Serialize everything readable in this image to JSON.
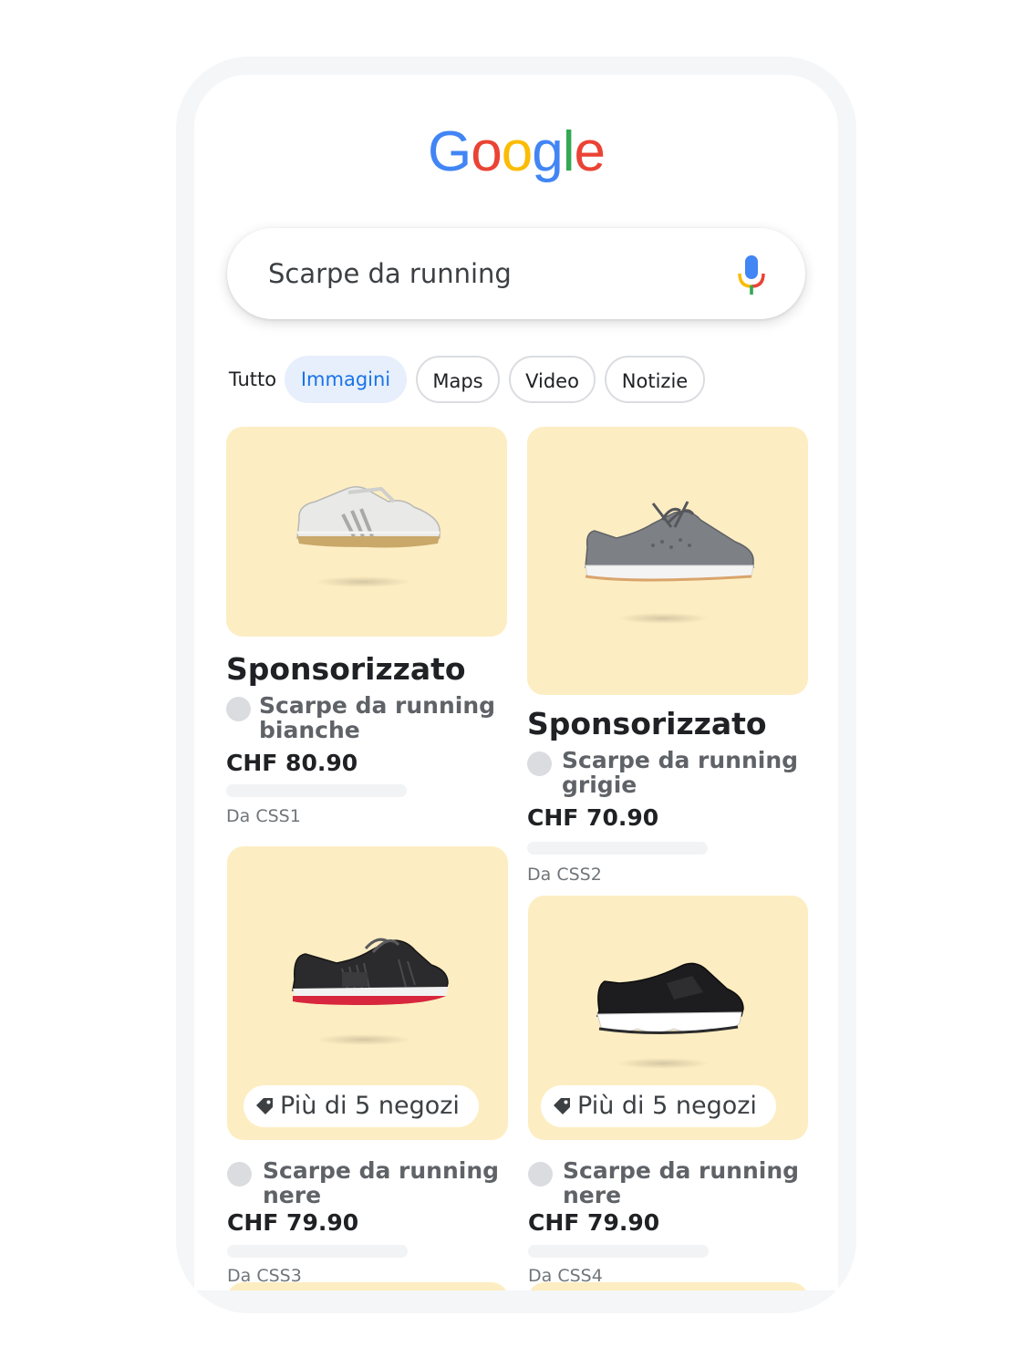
{
  "logo": {
    "letters": [
      {
        "char": "G",
        "color": "#4285F4"
      },
      {
        "char": "o",
        "color": "#EA4335"
      },
      {
        "char": "o",
        "color": "#FBBC05"
      },
      {
        "char": "g",
        "color": "#4285F4"
      },
      {
        "char": "l",
        "color": "#34A853"
      },
      {
        "char": "e",
        "color": "#EA4335"
      }
    ]
  },
  "search": {
    "query": "Scarpe da running",
    "mic_icon": "microphone-icon"
  },
  "tabs": [
    {
      "label": "Tutto",
      "active": false
    },
    {
      "label": "Immagini",
      "active": true
    },
    {
      "label": "Maps",
      "active": false
    },
    {
      "label": "Video",
      "active": false
    },
    {
      "label": "Notizie",
      "active": false
    }
  ],
  "results": [
    {
      "sponsored_label": "Sponsorizzato",
      "title_line1": "Scarpe da running",
      "title_line2": "bianche",
      "price": "CHF 80.90",
      "store": "Da CSS1",
      "image": "white-sneaker"
    },
    {
      "sponsored_label": "Sponsorizzato",
      "title_line1": "Scarpe da running",
      "title_line2": "grigie",
      "price": "CHF 70.90",
      "store": "Da CSS2",
      "image": "grey-sneaker"
    },
    {
      "badge": "Più di 5 negozi",
      "badge_icon": "tag-icon",
      "title_line1": "Scarpe da running",
      "title_line2": "nere",
      "price": "CHF 79.90",
      "store": "Da CSS3",
      "image": "black-red-sneaker"
    },
    {
      "badge": "Più di 5 negozi",
      "badge_icon": "tag-icon",
      "title_line1": "Scarpe da running",
      "title_line2": "nere",
      "price": "CHF 79.90",
      "store": "Da CSS4",
      "image": "black-slip-on-sneaker"
    }
  ],
  "colors": {
    "card_background": "#fdedc2",
    "active_tab_background": "#e6effb",
    "active_tab_text": "#1a73e8"
  }
}
